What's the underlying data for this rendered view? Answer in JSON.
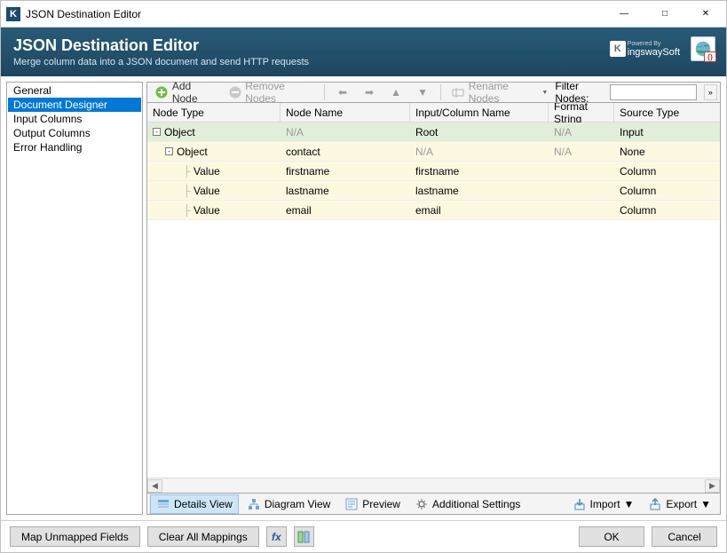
{
  "window": {
    "title": "JSON Destination Editor"
  },
  "banner": {
    "title": "JSON Destination Editor",
    "subtitle": "Merge column data into a JSON document and send HTTP requests",
    "powered_by": "Powered By",
    "brand": "ingswaySoft"
  },
  "sidebar": {
    "items": [
      {
        "label": "General",
        "selected": false
      },
      {
        "label": "Document Designer",
        "selected": true
      },
      {
        "label": "Input Columns",
        "selected": false
      },
      {
        "label": "Output Columns",
        "selected": false
      },
      {
        "label": "Error Handling",
        "selected": false
      }
    ]
  },
  "toolbar": {
    "add_node": "Add Node",
    "remove_nodes": "Remove Nodes",
    "rename_nodes": "Rename Nodes",
    "filter_label": "Filter Nodes:",
    "filter_value": ""
  },
  "grid": {
    "columns": {
      "node_type": "Node Type",
      "node_name": "Node Name",
      "input_col": "Input/Column Name",
      "format": "Format String",
      "source": "Source Type"
    },
    "rows": [
      {
        "indent": 0,
        "expand": "-",
        "node_type": "Object",
        "node_name": "N/A",
        "input_col": "Root",
        "format": "N/A",
        "source": "Input",
        "color": "green",
        "name_na": true,
        "format_na": true
      },
      {
        "indent": 1,
        "expand": "-",
        "node_type": "Object",
        "node_name": "contact",
        "input_col": "N/A",
        "format": "N/A",
        "source": "None",
        "color": "yellow",
        "input_na": true,
        "format_na": true
      },
      {
        "indent": 2,
        "expand": "",
        "node_type": "Value",
        "node_name": "firstname",
        "input_col": "firstname",
        "format": "",
        "source": "Column",
        "color": "yellow"
      },
      {
        "indent": 2,
        "expand": "",
        "node_type": "Value",
        "node_name": "lastname",
        "input_col": "lastname",
        "format": "",
        "source": "Column",
        "color": "yellow"
      },
      {
        "indent": 2,
        "expand": "",
        "node_type": "Value",
        "node_name": "email",
        "input_col": "email",
        "format": "",
        "source": "Column",
        "color": "yellow"
      }
    ]
  },
  "views": {
    "details": "Details View",
    "diagram": "Diagram View",
    "preview": "Preview",
    "additional": "Additional Settings",
    "import": "Import",
    "export": "Export"
  },
  "footer": {
    "map_unmapped": "Map Unmapped Fields",
    "clear_mappings": "Clear All Mappings",
    "ok": "OK",
    "cancel": "Cancel"
  }
}
